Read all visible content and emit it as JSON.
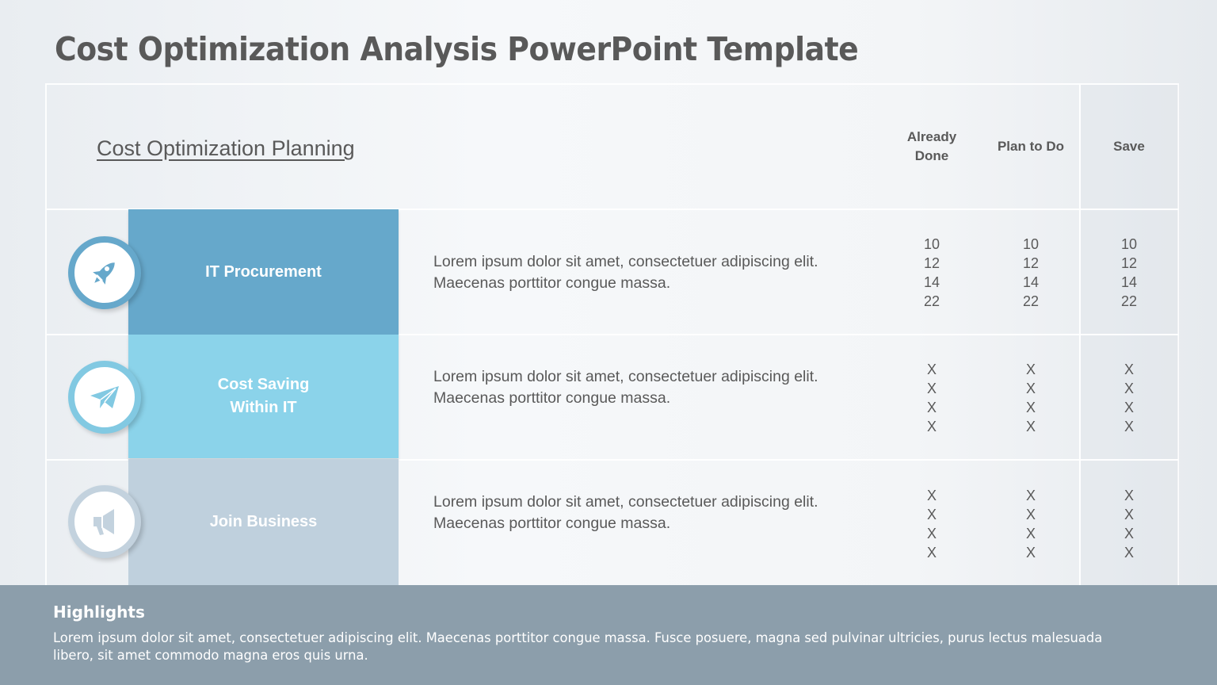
{
  "title": "Cost Optimization Analysis PowerPoint Template",
  "subtitle": "Cost Optimization Planning",
  "columns": [
    "Already Done",
    "Plan to Do",
    "Save"
  ],
  "rows": [
    {
      "label": "IT Procurement",
      "icon": "rocket-icon",
      "color": "#66a8cb",
      "ring_color": "#66a8cb",
      "description": "Lorem ipsum dolor sit amet, consectetuer adipiscing elit. Maecenas porttitor congue massa.",
      "values": {
        "already_done": "10\n12\n14\n22",
        "plan_to_do": "10\n12\n14\n22",
        "save": "10\n12\n14\n22"
      }
    },
    {
      "label": "Cost Saving Within IT",
      "icon": "paper-plane-icon",
      "color": "#8bd3ea",
      "ring_color": "#82c9e2",
      "description": "Lorem ipsum dolor sit amet, consectetuer adipiscing elit. Maecenas porttitor congue massa.",
      "values": {
        "already_done": "X\nX\nX\nX",
        "plan_to_do": "X\nX\nX\nX",
        "save": "X\nX\nX\nX"
      }
    },
    {
      "label": "Join Business",
      "icon": "megaphone-icon",
      "color": "#bfd0dd",
      "ring_color": "#c3d2de",
      "description": "Lorem ipsum dolor sit amet, consectetuer adipiscing elit. Maecenas porttitor congue massa.",
      "values": {
        "already_done": "X\nX\nX\nX",
        "plan_to_do": "X\nX\nX\nX",
        "save": "X\nX\nX\nX"
      }
    }
  ],
  "footer": {
    "title": "Highlights",
    "text": "Lorem ipsum dolor sit amet, consectetuer adipiscing elit. Maecenas porttitor congue massa. Fusce posuere, magna sed pulvinar ultricies, purus lectus malesuada libero, sit amet commodo magna eros quis urna.",
    "background": "#8c9eab"
  }
}
